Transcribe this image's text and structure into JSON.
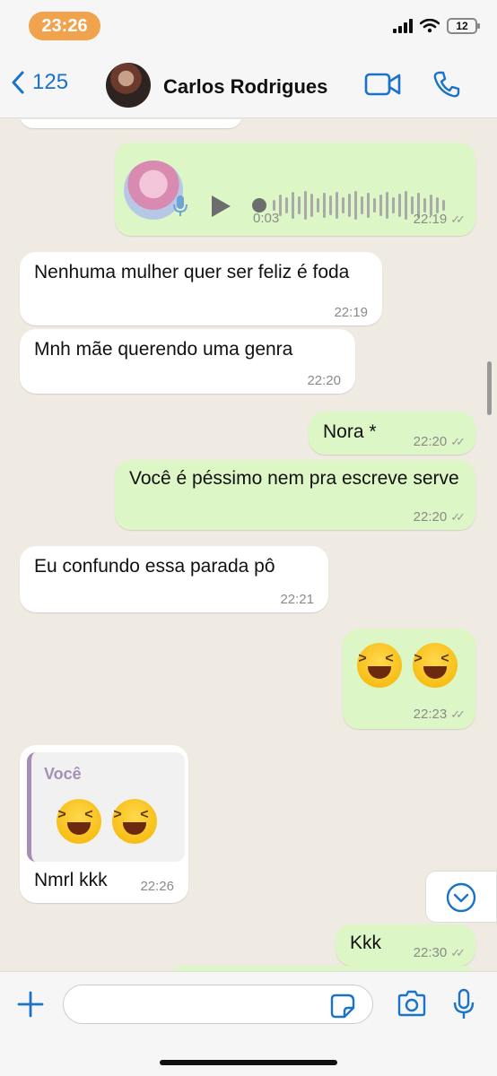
{
  "status_bar": {
    "time": "23:26",
    "battery": "12"
  },
  "header": {
    "back_count": "125",
    "contact_name": "Carlos Rodrigues"
  },
  "messages": [
    {
      "type": "voice",
      "direction": "out",
      "duration": "0:03",
      "time": "22:19"
    },
    {
      "direction": "in",
      "text": "Nenhuma mulher quer ser feliz é foda",
      "time": "22:19"
    },
    {
      "direction": "in",
      "text": "Mnh mãe querendo uma genra",
      "time": "22:20"
    },
    {
      "direction": "out",
      "text": "Nora *",
      "time": "22:20"
    },
    {
      "direction": "out",
      "text": "Você é péssimo nem pra escreve serve",
      "time": "22:20"
    },
    {
      "direction": "in",
      "text": "Eu confundo essa parada pô",
      "time": "22:21"
    },
    {
      "direction": "out",
      "type": "emoji",
      "time": "22:23"
    },
    {
      "direction": "in",
      "quoted_author": "Você",
      "text": "Nmrl kkk",
      "time": "22:26"
    },
    {
      "direction": "out",
      "text": "Kkk",
      "time": "22:30"
    }
  ],
  "colors": {
    "accent": "#1a73c8",
    "outgoing": "#dcf7c5",
    "incoming": "#ffffff",
    "background": "#efeae2",
    "time_pill": "#f0a24d"
  },
  "icons": [
    "back-chevron-icon",
    "video-call-icon",
    "phone-icon",
    "plus-icon",
    "sticker-icon",
    "camera-icon",
    "microphone-icon",
    "chevron-down-icon",
    "play-icon",
    "read-ticks-icon"
  ]
}
